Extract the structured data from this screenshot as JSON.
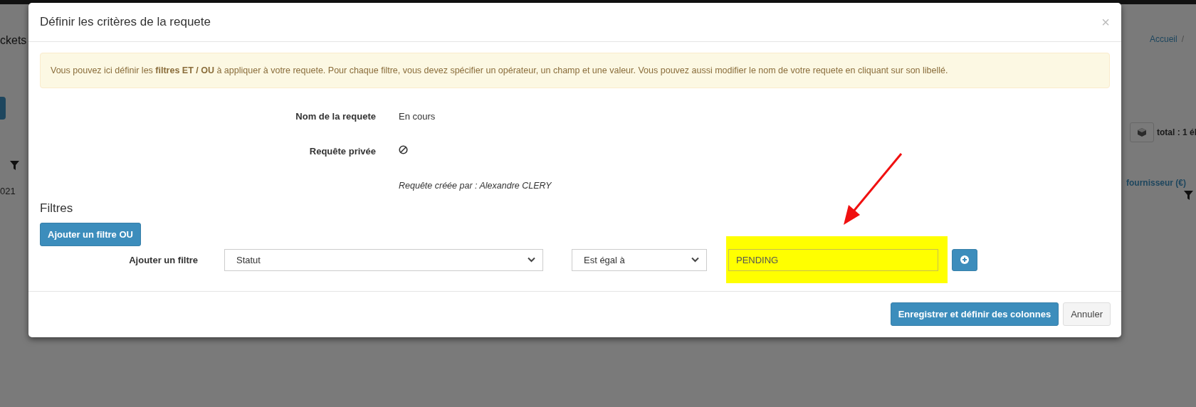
{
  "background": {
    "page_title": "ckets",
    "breadcrumb": [
      "Accueil",
      "/"
    ],
    "total": "total : 1 él",
    "column_header": "fournisseur (€)",
    "cell": "021"
  },
  "modal": {
    "title": "Définir les critères de la requete",
    "close": "×",
    "notice": "Vous pouvez ici définir les **filtres ET / OU** à appliquer à votre requete. Pour chaque filtre, vous devez spécifier un opérateur, un champ et une valeur. Vous pouvez aussi modifier le nom de votre requete en cliquant sur son libellé.",
    "name_field": {
      "label": "Nom de la requete",
      "value": "En cours"
    },
    "private_field": {
      "label": "Requête privée",
      "checked": false
    },
    "creator": "Requête créée par : Alexandre CLERY",
    "filters_heading": "Filtres",
    "add_or_button": "Ajouter un filtre OU",
    "add_filter": {
      "label": "Ajouter un filtre",
      "field": "Statut",
      "operator": "Est égal à",
      "value": "PENDING",
      "highlighted": true
    },
    "buttons": [
      {
        "label": "Enregistrer et définir des colonnes",
        "kind": "primary"
      },
      {
        "label": "Annuler",
        "kind": "default"
      }
    ]
  }
}
